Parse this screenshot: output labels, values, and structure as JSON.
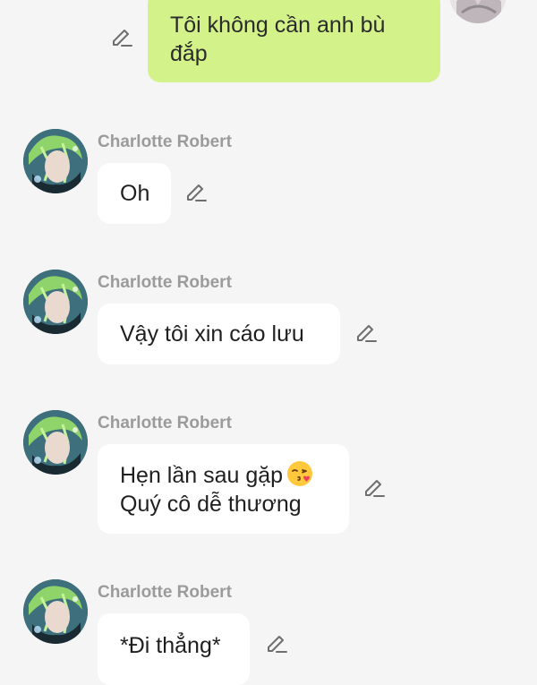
{
  "conversation": {
    "outgoing": {
      "text_line1": "Tôi không cần anh bù",
      "text_line2": "đắp"
    },
    "contact_name": "Charlotte Robert",
    "messages": [
      {
        "sender": "Charlotte Robert",
        "lines": [
          "Oh"
        ]
      },
      {
        "sender": "Charlotte Robert",
        "lines": [
          "Vậy tôi xin cáo lưu"
        ]
      },
      {
        "sender": "Charlotte Robert",
        "lines": [
          "Hẹn lần sau gặp",
          "Quý cô dễ thương"
        ],
        "emoji": "face-blowing-a-kiss"
      },
      {
        "sender": "Charlotte Robert",
        "lines": [
          "*Đi thẳng*"
        ]
      }
    ]
  },
  "colors": {
    "background": "#f5f5f5",
    "incoming_bubble": "#ffffff",
    "outgoing_bubble": "#d4f28a",
    "sender_name": "#9b9b9b",
    "edit_icon": "#6e6e6e"
  },
  "icons": {
    "edit": "pencil-icon",
    "avatar": "contact-avatar",
    "self_avatar": "self-avatar"
  }
}
